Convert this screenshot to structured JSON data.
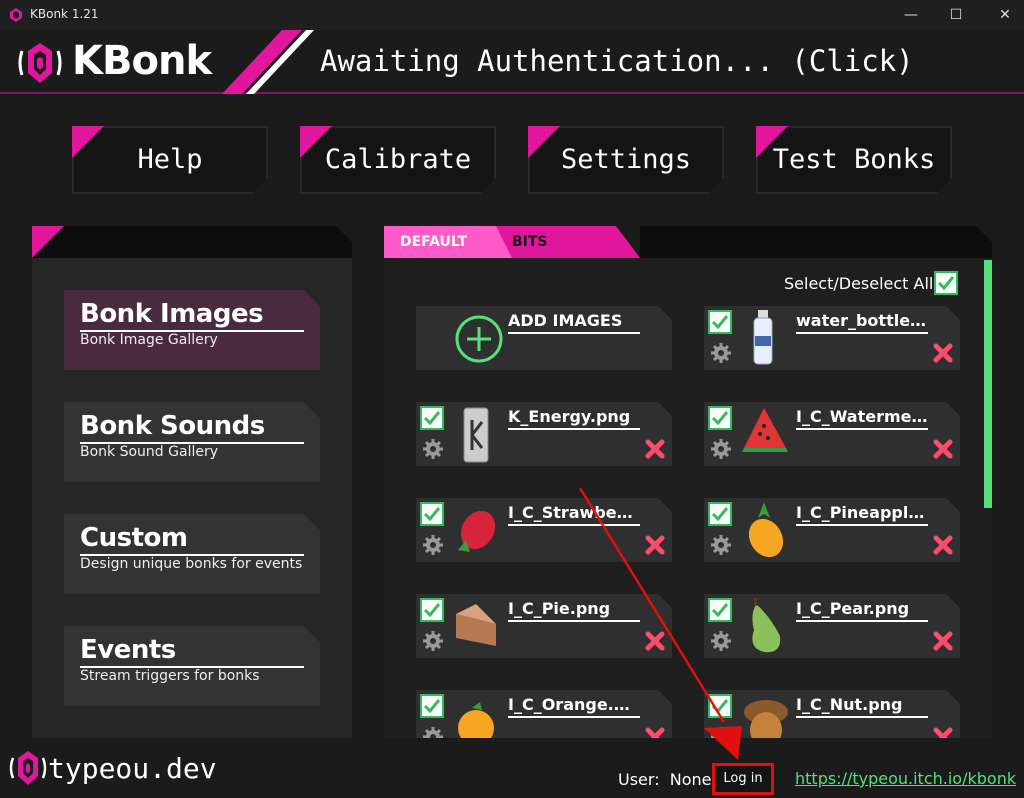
{
  "window": {
    "title": "KBonk 1.21",
    "minimize": "—",
    "maximize": "☐",
    "close": "✕"
  },
  "header": {
    "logo_text": "KBonk",
    "status": "Awaiting Authentication... (Click)"
  },
  "nav": {
    "help": "Help",
    "calibrate": "Calibrate",
    "settings": "Settings",
    "test_bonks": "Test Bonks"
  },
  "sidebar": {
    "items": [
      {
        "title": "Bonk Images",
        "subtitle": "Bonk Image Gallery",
        "active": true
      },
      {
        "title": "Bonk Sounds",
        "subtitle": "Bonk Sound Gallery",
        "active": false
      },
      {
        "title": "Custom",
        "subtitle": "Design unique bonks for events",
        "active": false
      },
      {
        "title": "Events",
        "subtitle": "Stream triggers for bonks",
        "active": false
      }
    ]
  },
  "tabs": {
    "default": "DEFAULT",
    "bits": "BITS"
  },
  "gallery": {
    "select_all": "Select/Deselect All",
    "add_label": "ADD IMAGES",
    "items": [
      {
        "name": "water_bottle.png",
        "checked": true,
        "icon": "water-bottle-thumb"
      },
      {
        "name": "K_Energy.png",
        "checked": true,
        "icon": "energy-can-thumb"
      },
      {
        "name": "I_C_Watermell...",
        "checked": true,
        "icon": "watermelon-thumb"
      },
      {
        "name": "I_C_Strawberry....",
        "checked": true,
        "icon": "strawberry-thumb"
      },
      {
        "name": "I_C_Pineapple....",
        "checked": true,
        "icon": "pineapple-thumb"
      },
      {
        "name": "I_C_Pie.png",
        "checked": true,
        "icon": "pie-thumb"
      },
      {
        "name": "I_C_Pear.png",
        "checked": true,
        "icon": "pear-thumb"
      },
      {
        "name": "I_C_Orange.png",
        "checked": true,
        "icon": "orange-thumb"
      },
      {
        "name": "I_C_Nut.png",
        "checked": true,
        "icon": "nut-thumb"
      }
    ]
  },
  "footer": {
    "brand": "typeou.dev",
    "user_label": "User:",
    "user_value": "None",
    "login": "Log in",
    "link": "https://typeou.itch.io/kbonk"
  },
  "colors": {
    "accent": "#e0169d",
    "accent_light": "#ff5ac9",
    "green": "#55e07a",
    "delete": "#ff4b6e"
  }
}
